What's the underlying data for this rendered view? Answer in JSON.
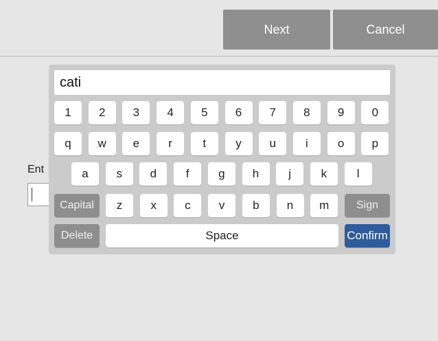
{
  "toolbar": {
    "next_label": "Next",
    "cancel_label": "Cancel"
  },
  "background": {
    "label_partial": "Ent",
    "input_value": ""
  },
  "keyboard": {
    "display_value": "cati",
    "row1": [
      "1",
      "2",
      "3",
      "4",
      "5",
      "6",
      "7",
      "8",
      "9",
      "0"
    ],
    "row2": [
      "q",
      "w",
      "e",
      "r",
      "t",
      "y",
      "u",
      "i",
      "o",
      "p"
    ],
    "row3": [
      "a",
      "s",
      "d",
      "f",
      "g",
      "h",
      "j",
      "k",
      "l"
    ],
    "row4": {
      "capital": "Capital",
      "letters": [
        "z",
        "x",
        "c",
        "v",
        "b",
        "n",
        "m"
      ],
      "sign": "Sign"
    },
    "row5": {
      "delete": "Delete",
      "space": "Space",
      "confirm": "Confirm"
    },
    "colors": {
      "function_key": "#8e8e8e",
      "confirm_key": "#2e5b9c",
      "toolbar_button": "#8f8f8f"
    }
  }
}
